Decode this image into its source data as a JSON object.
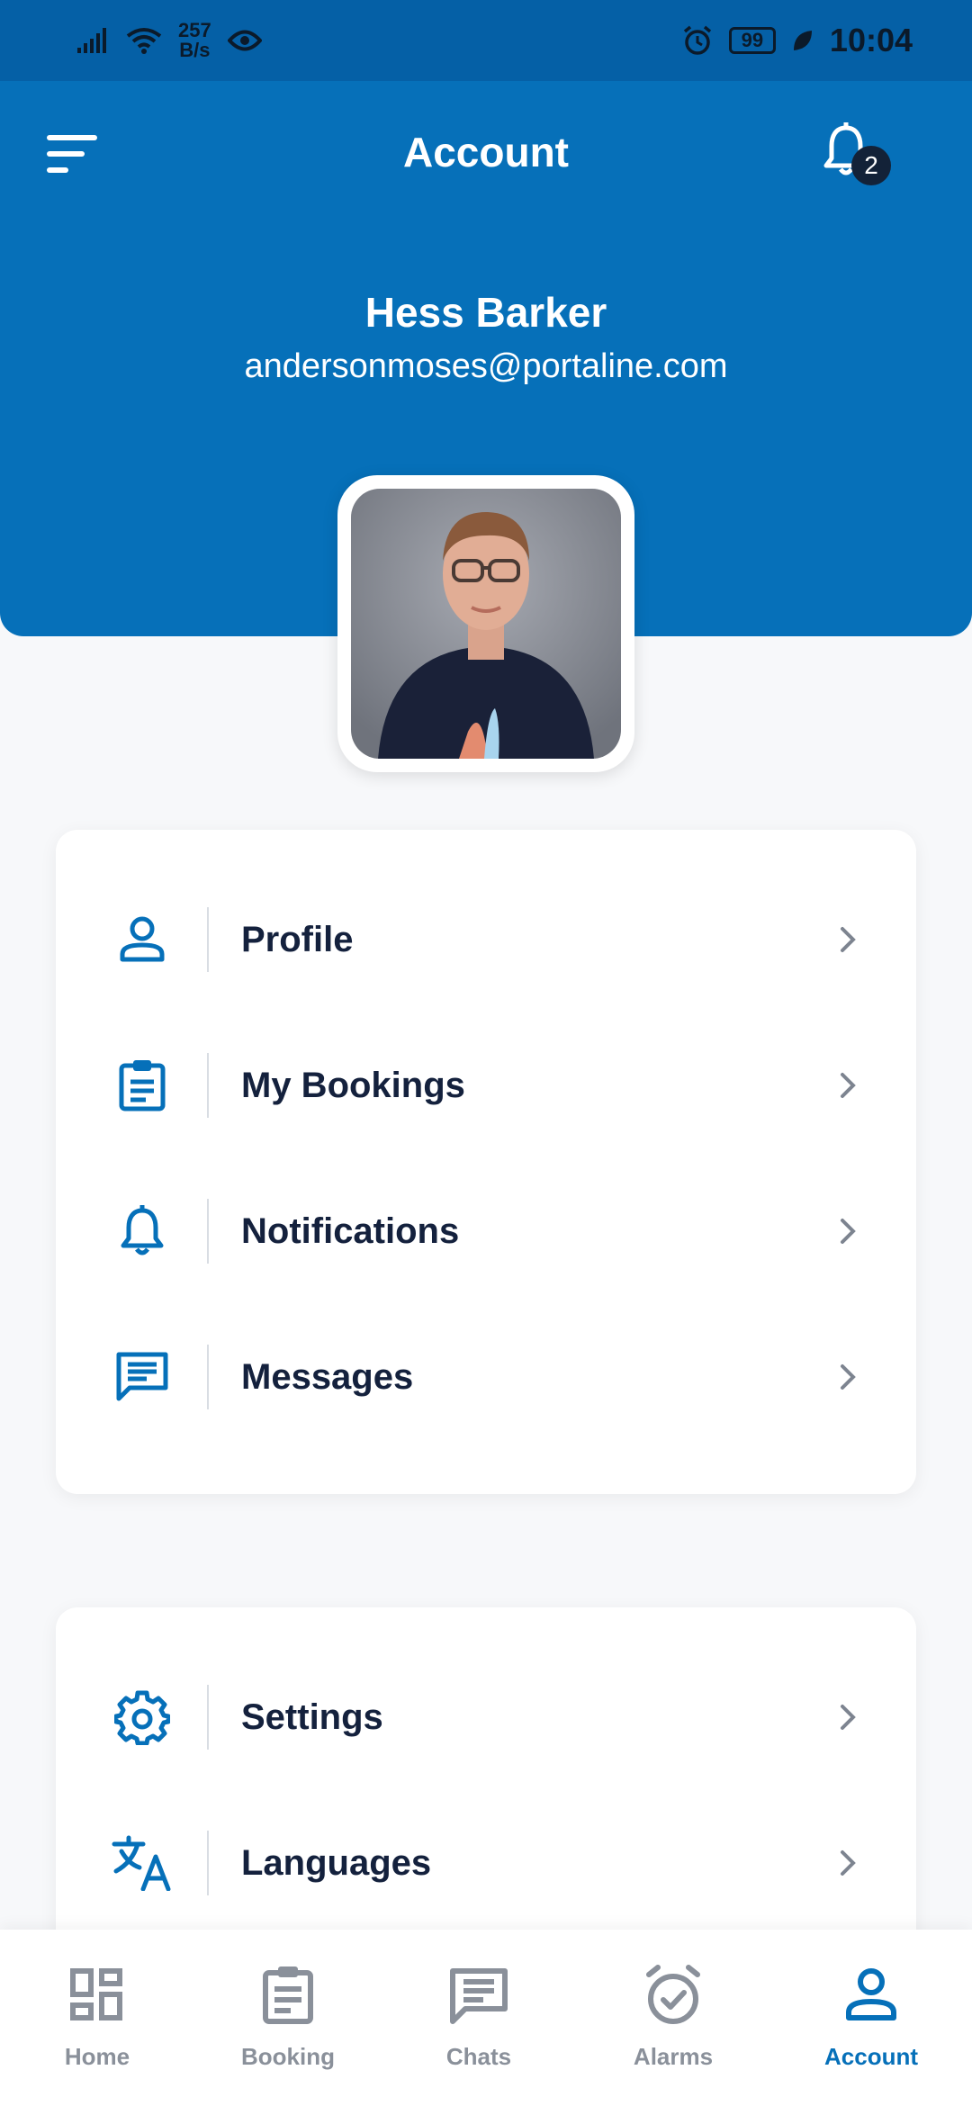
{
  "status_bar": {
    "net_speed_value": "257",
    "net_speed_unit": "B/s",
    "battery": "99",
    "time": "10:04"
  },
  "header": {
    "title": "Account",
    "notification_count": "2",
    "user_name": "Hess Barker",
    "user_email": "andersonmoses@portaline.com"
  },
  "menu_primary": [
    {
      "label": "Profile",
      "icon": "person-icon"
    },
    {
      "label": "My Bookings",
      "icon": "clipboard-icon"
    },
    {
      "label": "Notifications",
      "icon": "bell-icon"
    },
    {
      "label": "Messages",
      "icon": "message-icon"
    }
  ],
  "menu_secondary": [
    {
      "label": "Settings",
      "icon": "gear-icon"
    },
    {
      "label": "Languages",
      "icon": "translate-icon"
    }
  ],
  "bottom_nav": [
    {
      "label": "Home",
      "icon": "dashboard-icon"
    },
    {
      "label": "Booking",
      "icon": "clipboard-icon"
    },
    {
      "label": "Chats",
      "icon": "chat-icon"
    },
    {
      "label": "Alarms",
      "icon": "alarm-check-icon"
    },
    {
      "label": "Account",
      "icon": "person-icon"
    }
  ],
  "colors": {
    "primary": "#0670b9",
    "status_bar": "#0560a6",
    "text_dark": "#14213d",
    "nav_inactive": "#8a909a",
    "badge": "#132238"
  }
}
